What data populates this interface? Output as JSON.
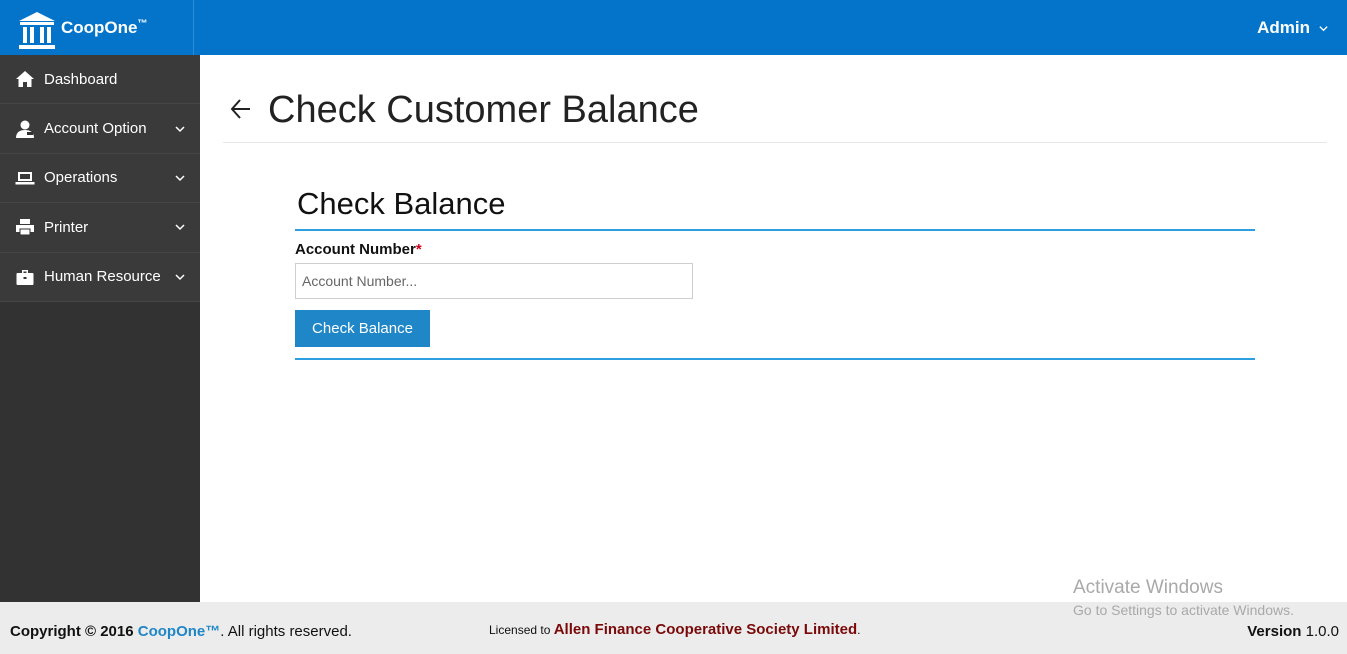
{
  "header": {
    "brand_name": "CoopOne",
    "brand_tm": "™",
    "user_label": "Admin"
  },
  "sidebar": {
    "items": [
      {
        "label": "Dashboard",
        "icon": "home-icon",
        "has_submenu": false
      },
      {
        "label": "Account Option",
        "icon": "user-icon",
        "has_submenu": true
      },
      {
        "label": "Operations",
        "icon": "laptop-icon",
        "has_submenu": true
      },
      {
        "label": "Printer",
        "icon": "printer-icon",
        "has_submenu": true
      },
      {
        "label": "Human Resource",
        "icon": "briefcase-icon",
        "has_submenu": true
      }
    ]
  },
  "page": {
    "title": "Check Customer Balance"
  },
  "form": {
    "title": "Check Balance",
    "account_label": "Account Number",
    "required_mark": "*",
    "account_placeholder": "Account Number...",
    "account_value": "",
    "submit_label": "Check Balance"
  },
  "footer": {
    "copyright_prefix": "Copyright © 2016 ",
    "copyright_brand": "CoopOne™",
    "copyright_suffix": ". All rights reserved.",
    "license_prefix": "Licensed to ",
    "license_org": "Allen Finance Cooperative Society Limited",
    "license_suffix": ".",
    "version_label": "Version",
    "version_value": "1.0.0"
  },
  "watermark": {
    "line1": "Activate Windows",
    "line2": "Go to Settings to activate Windows."
  },
  "colors": {
    "topbar": "#0374c9",
    "sidebar": "#323232",
    "accent": "#2d9ee0",
    "button": "#1f86c7",
    "license_org": "#7a0a0a"
  }
}
